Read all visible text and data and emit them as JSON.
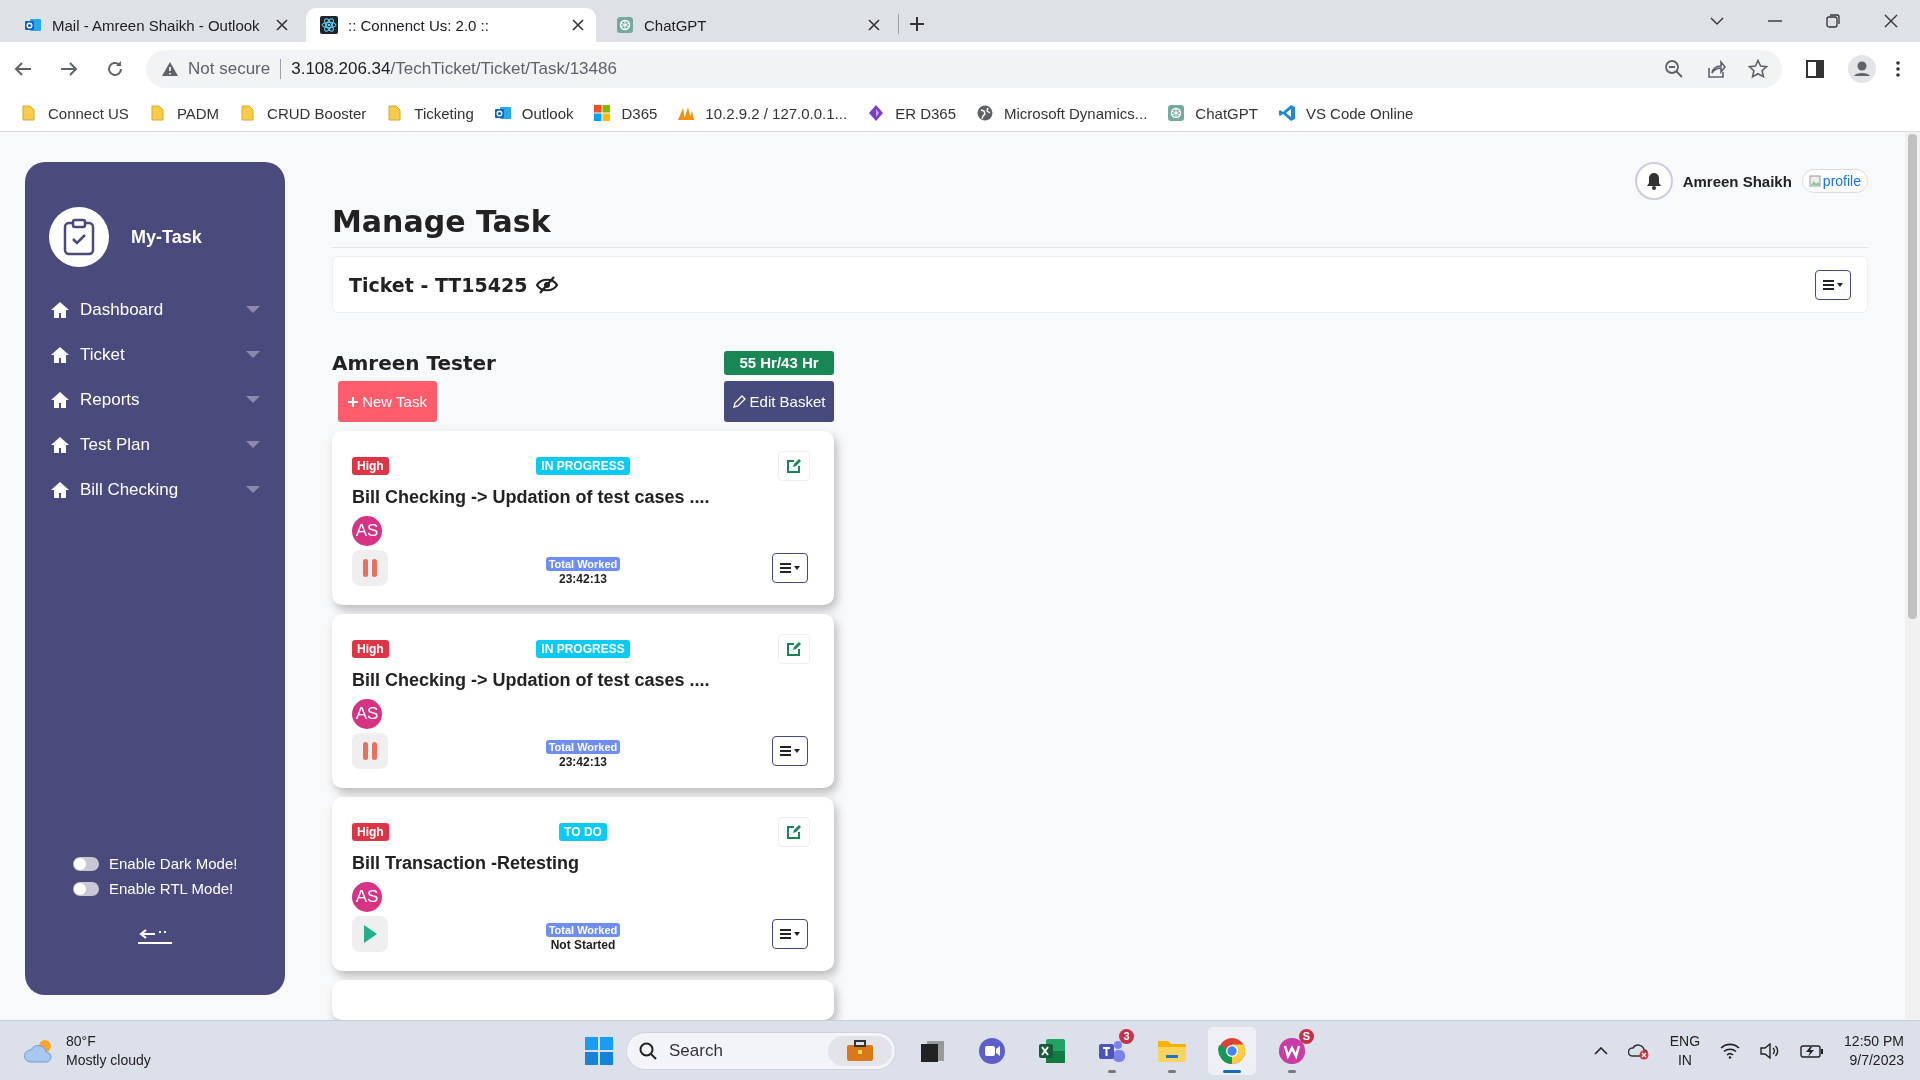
{
  "browser": {
    "tabs": [
      {
        "title": "Mail - Amreen Shaikh - Outlook",
        "kind": "outlook",
        "selected": false
      },
      {
        "title": ":: Connenct Us: 2.0 ::",
        "kind": "react",
        "selected": true
      },
      {
        "title": "ChatGPT",
        "kind": "chatgpt",
        "selected": false
      }
    ],
    "address": {
      "security": "Not secure",
      "host": "3.108.206.34",
      "path": "/TechTicket/Ticket/Task/13486"
    },
    "bookmarks": [
      {
        "label": "Connect US",
        "kind": "folder"
      },
      {
        "label": "PADM",
        "kind": "folder"
      },
      {
        "label": "CRUD Booster",
        "kind": "folder"
      },
      {
        "label": "Ticketing",
        "kind": "folder"
      },
      {
        "label": "Outlook",
        "kind": "outlook"
      },
      {
        "label": "D365",
        "kind": "tiles"
      },
      {
        "label": "10.2.9.2 / 127.0.0.1...",
        "kind": "pma"
      },
      {
        "label": "ER D365",
        "kind": "diamond"
      },
      {
        "label": "Microsoft Dynamics...",
        "kind": "globe"
      },
      {
        "label": "ChatGPT",
        "kind": "chatgpt"
      },
      {
        "label": "VS Code Online",
        "kind": "vscode"
      }
    ]
  },
  "sidebar": {
    "brand": "My-Task",
    "items": [
      {
        "label": "Dashboard"
      },
      {
        "label": "Ticket"
      },
      {
        "label": "Reports"
      },
      {
        "label": "Test Plan"
      },
      {
        "label": "Bill Checking"
      }
    ],
    "toggles": [
      {
        "label": "Enable Dark Mode!",
        "on": false
      },
      {
        "label": "Enable RTL Mode!",
        "on": false
      }
    ]
  },
  "header": {
    "user": "Amreen Shaikh",
    "avatar_alt": "profile"
  },
  "title": "Manage Task",
  "ticket": {
    "label": "Ticket - TT15425"
  },
  "basket": {
    "owner": "Amreen Tester",
    "hours": "55 Hr/43 Hr",
    "new_task": "New Task",
    "edit": "Edit Basket"
  },
  "tasks": [
    {
      "priority": "High",
      "status": "IN PROGRESS",
      "title": "Bill Checking -> Updation of test cases ....",
      "assignee": "AS",
      "running": true,
      "worked_label": "Total Worked",
      "worked": "23:42:13"
    },
    {
      "priority": "High",
      "status": "IN PROGRESS",
      "title": "Bill Checking -> Updation of test cases ....",
      "assignee": "AS",
      "running": true,
      "worked_label": "Total Worked",
      "worked": "23:42:13"
    },
    {
      "priority": "High",
      "status": "TO DO",
      "title": "Bill Transaction -Retesting",
      "assignee": "AS",
      "running": false,
      "worked_label": "Total Worked",
      "worked": "Not Started"
    }
  ],
  "taskbar": {
    "weather_temp": "80°F",
    "weather_text": "Mostly cloudy",
    "search_placeholder": "Search",
    "apps": [
      {
        "kind": "task-view",
        "open": false,
        "selected": false
      },
      {
        "kind": "meet",
        "open": false,
        "selected": false
      },
      {
        "kind": "excel",
        "open": false,
        "selected": false
      },
      {
        "kind": "teams",
        "open": true,
        "selected": false,
        "badge": "3"
      },
      {
        "kind": "files",
        "open": true,
        "selected": false
      },
      {
        "kind": "chrome",
        "open": true,
        "selected": true
      },
      {
        "kind": "wps",
        "open": true,
        "selected": false,
        "badge": "S"
      }
    ],
    "lang": "ENG",
    "region": "IN",
    "time": "12:50 PM",
    "date": "9/7/2023"
  }
}
